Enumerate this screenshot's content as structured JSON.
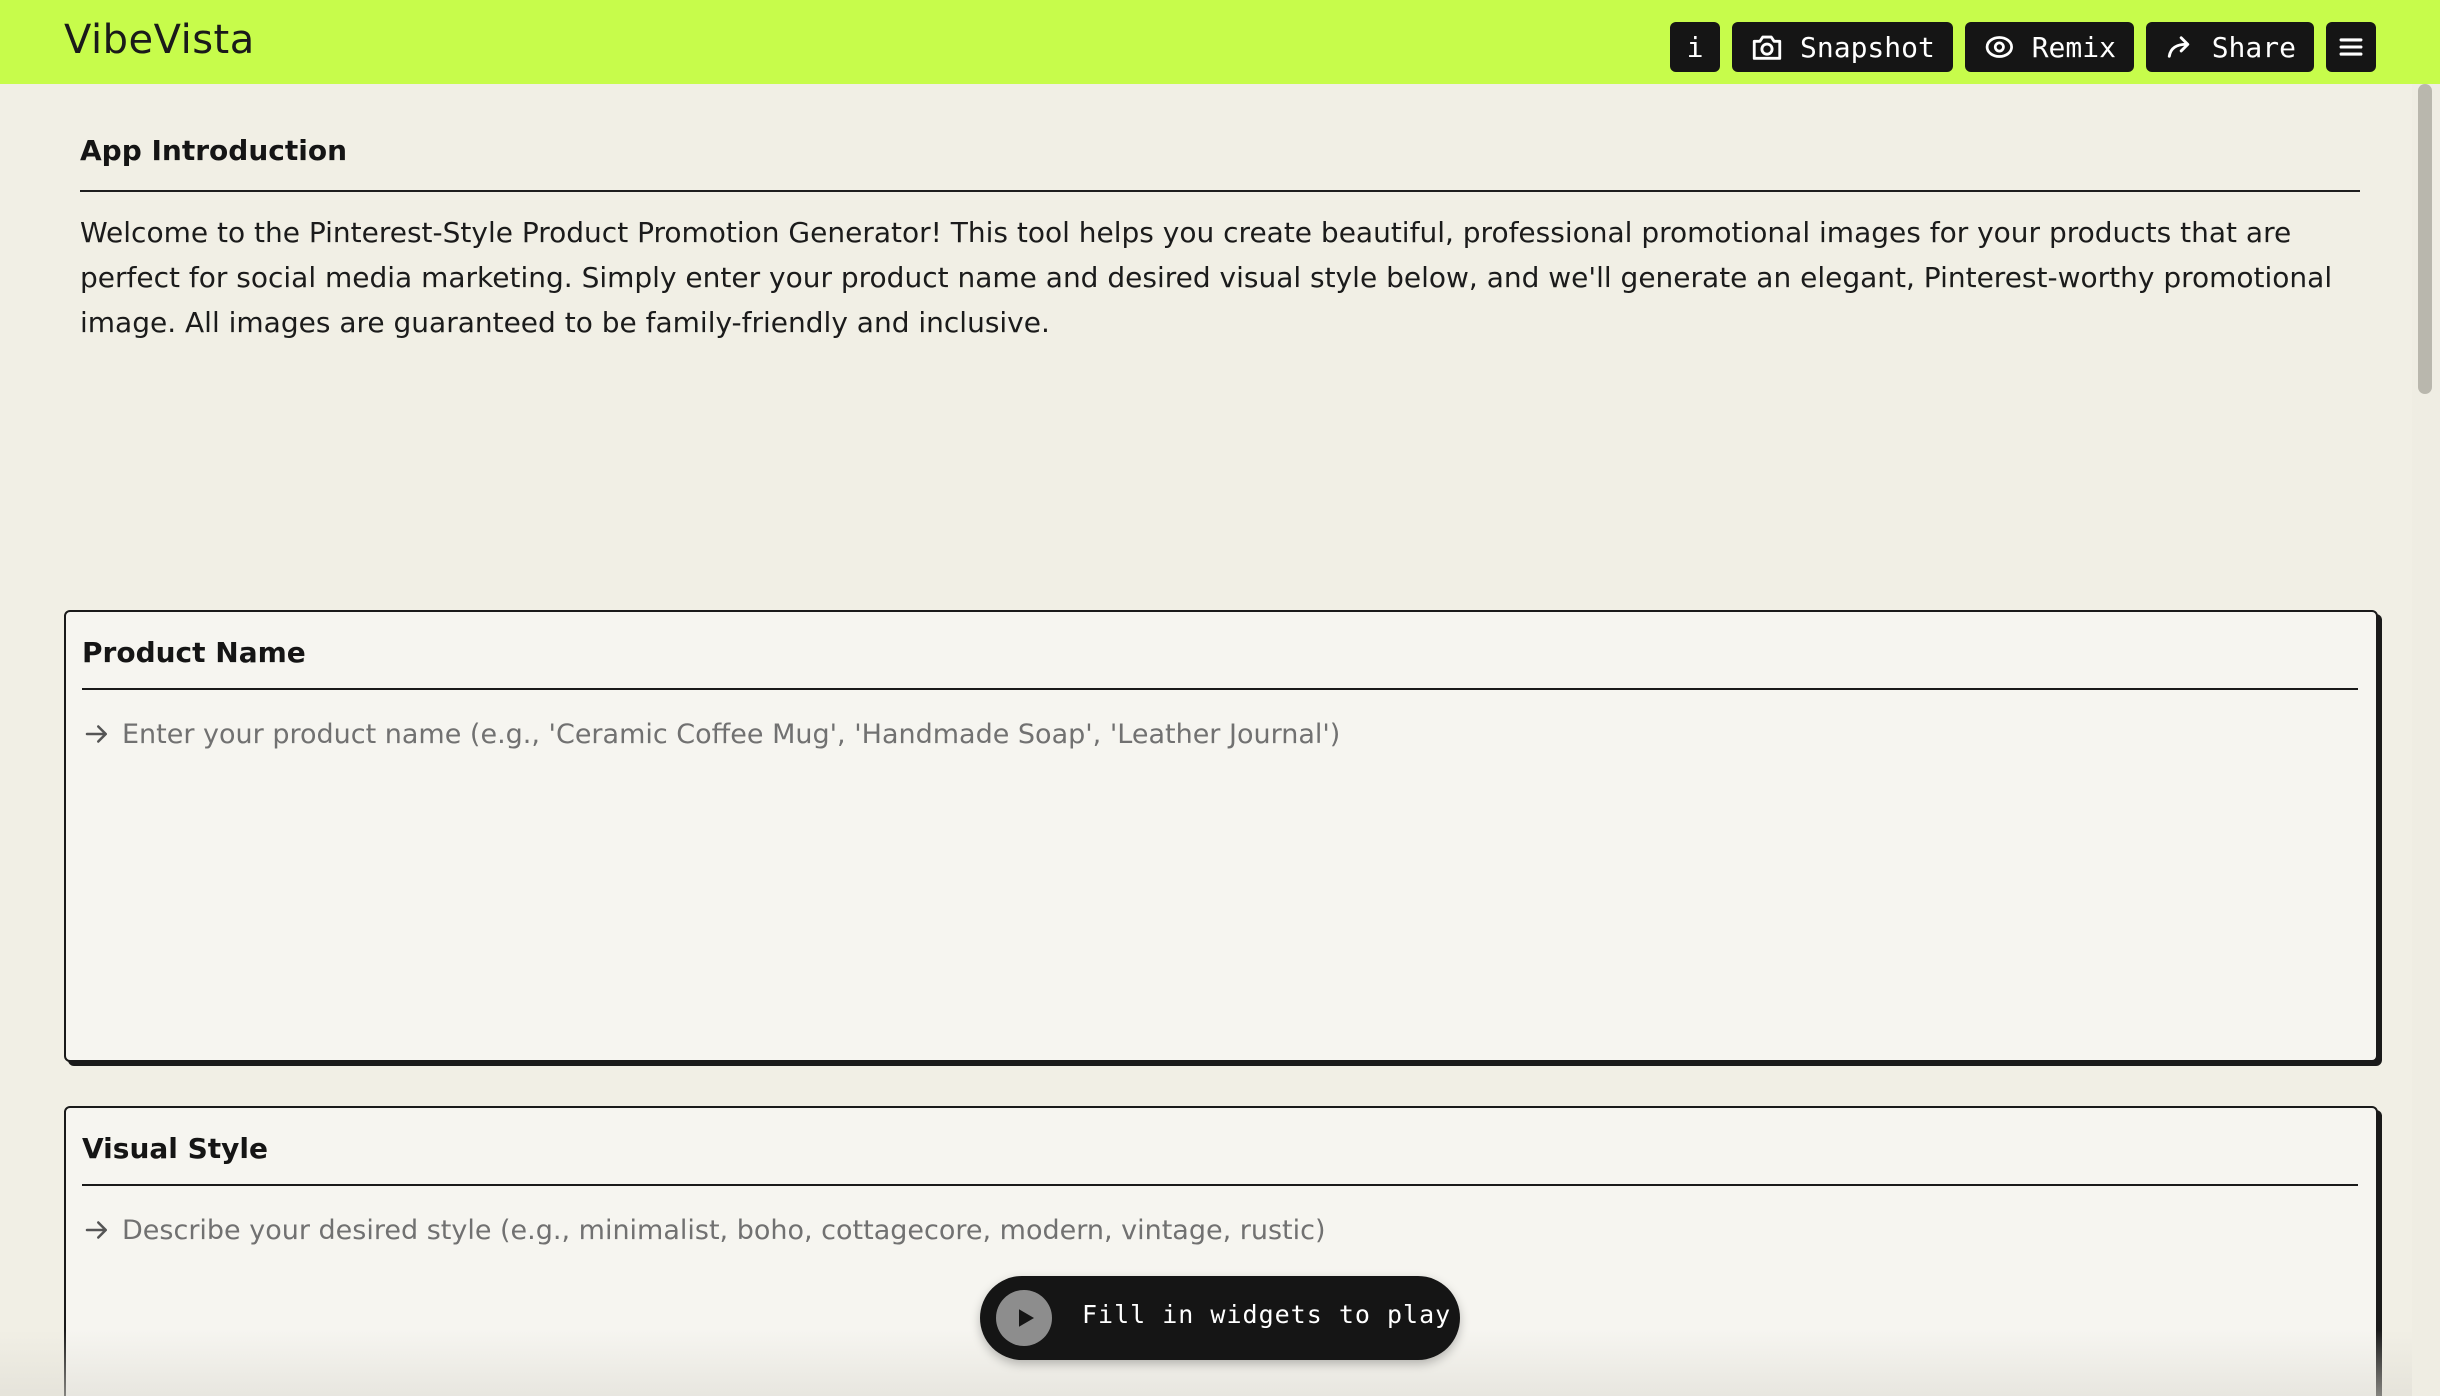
{
  "app": {
    "title": "VibeVista"
  },
  "toolbar": {
    "info_label": "i",
    "snapshot_label": "Snapshot",
    "remix_label": "Remix",
    "share_label": "Share",
    "icons": [
      "camera-icon",
      "remix-icon",
      "share-arrow-icon",
      "hamburger-menu-icon"
    ]
  },
  "intro": {
    "title": "App Introduction",
    "text": "Welcome to the Pinterest-Style Product Promotion Generator! This tool helps you create beautiful, professional promotional images for your products that are perfect for social media marketing. Simply enter your product name and desired visual style below, and we'll generate an elegant, Pinterest-worthy promotional image. All images are guaranteed to be family-friendly and inclusive."
  },
  "widgets": {
    "product": {
      "title": "Product Name",
      "value": "",
      "placeholder": "Enter your product name (e.g., 'Ceramic Coffee Mug', 'Handmade Soap', 'Leather Journal')"
    },
    "visual": {
      "title": "Visual Style",
      "value": "",
      "placeholder": "Describe your desired style (e.g., minimalist, boho, cottagecore, modern, vintage, rustic)"
    }
  },
  "play": {
    "label": "Fill in widgets to play"
  },
  "colors": {
    "topbar": "#c7fc4b",
    "page_bg": "#f1efe5",
    "button_bg": "#151515"
  }
}
